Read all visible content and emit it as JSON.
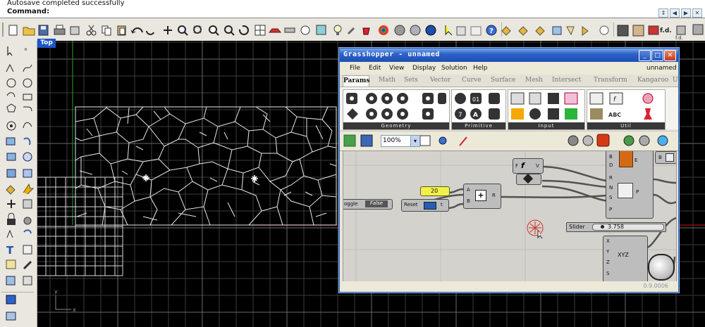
{
  "command": {
    "history": "Autosave completed successfully",
    "prompt": "Command:"
  },
  "viewport": {
    "label": "Top",
    "axis_x": "x",
    "axis_y": "y"
  },
  "grasshopper": {
    "title": "Grasshopper - unnamed",
    "menu": [
      "File",
      "Edit",
      "View",
      "Display",
      "Solution",
      "Help"
    ],
    "doc_name": "unnamed",
    "tabs": [
      "Params",
      "Math",
      "Sets",
      "Vector",
      "Curve",
      "Surface",
      "Mesh",
      "Intersect",
      "Transform",
      "Kangaroo",
      "U"
    ],
    "panels": [
      "Geometry",
      "Primitive",
      "Input",
      "Util"
    ],
    "zoom": "100%",
    "version": "0.9.0006",
    "nodes": {
      "number_value": "20",
      "toggle_label": "oggle",
      "toggle_value": "False",
      "reset_label": "Reset",
      "reset_out": "t",
      "add_in_a": "A",
      "add_in_b": "B",
      "add_out": "R",
      "fx_in": "F",
      "fx_out": "V",
      "slider_label": "Slider",
      "slider_value": "3.758",
      "big_in_b": "B",
      "big_in_d": "D",
      "big_out_e": "E",
      "big_in_r": "R",
      "big_in_n": "N",
      "big_in_s": "S",
      "big_in_p": "P",
      "big_out_p": "P",
      "right_in_b": "B",
      "vec_in_x": "X",
      "vec_in_y": "Y",
      "vec_in_z": "Z",
      "vec_in_s": "S",
      "vec_label": "XYZ"
    }
  }
}
